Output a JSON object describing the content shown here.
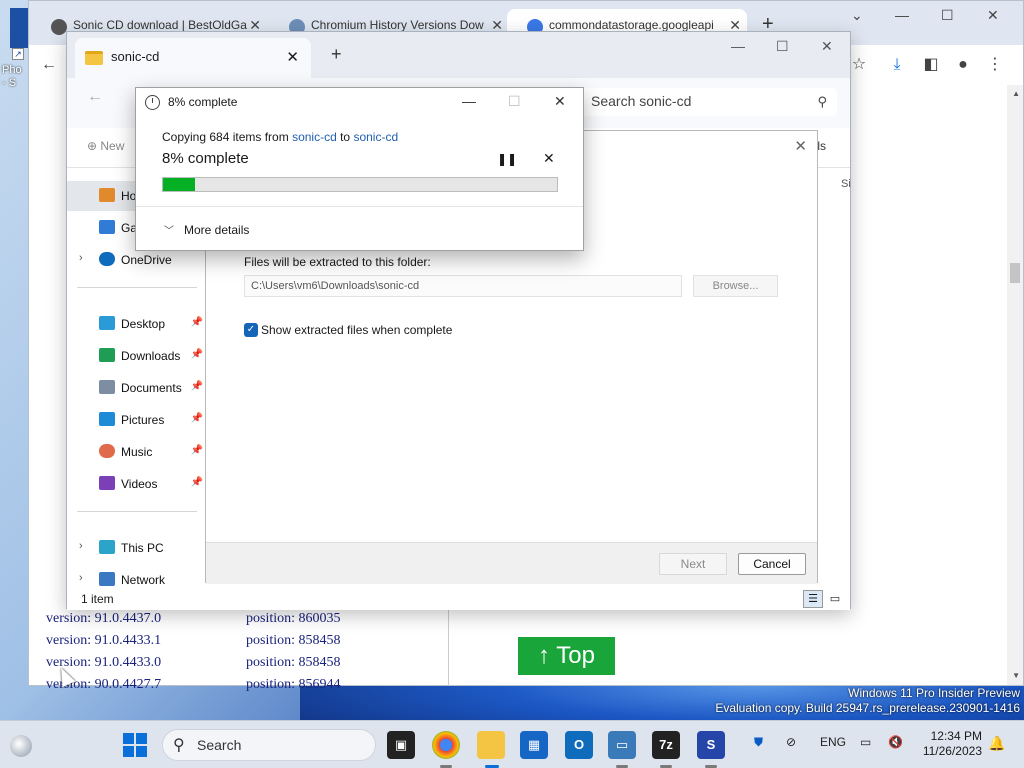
{
  "desktop": {
    "icon_label": "Pho\n- S",
    "watermark_line1": "Windows 11 Pro Insider Preview",
    "watermark_line2": "Evaluation copy. Build 25947.rs_prerelease.230901-1416"
  },
  "browser": {
    "tabs": [
      {
        "title": "Sonic CD download | BestOldGa",
        "close": "✕"
      },
      {
        "title": "Chromium History Versions Dow",
        "close": "✕"
      },
      {
        "title": "commondatastorage.googleapi",
        "close": "✕"
      }
    ],
    "new_tab": "+",
    "versions": [
      {
        "version": "version: 91.0.4437.0",
        "position": "position: 860035"
      },
      {
        "version": "version: 91.0.4433.1",
        "position": "position: 858458"
      },
      {
        "version": "version: 91.0.4433.0",
        "position": "position: 858458"
      },
      {
        "version": "version: 90.0.4427.7",
        "position": "position: 856944"
      }
    ],
    "top_button": "↑ Top"
  },
  "explorer": {
    "tab_title": "sonic-cd",
    "search_placeholder": "Search sonic-cd",
    "new_label": "New",
    "details_label": "ls",
    "col_header": "Si",
    "sidebar": [
      {
        "label": "Ho",
        "icon": "home-icon"
      },
      {
        "label": "Ga",
        "icon": "gallery-icon"
      },
      {
        "label": "OneDrive",
        "icon": "onedrive-icon"
      },
      {
        "label": "Desktop",
        "icon": "desktop-icon"
      },
      {
        "label": "Downloads",
        "icon": "downloads-icon"
      },
      {
        "label": "Documents",
        "icon": "documents-icon"
      },
      {
        "label": "Pictures",
        "icon": "pictures-icon"
      },
      {
        "label": "Music",
        "icon": "music-icon"
      },
      {
        "label": "Videos",
        "icon": "videos-icon"
      },
      {
        "label": "This PC",
        "icon": "this-pc-icon"
      },
      {
        "label": "Network",
        "icon": "network-icon"
      }
    ],
    "status": "1 item"
  },
  "wizard": {
    "folder_label": "Files will be extracted to this folder:",
    "path": "C:\\Users\\vm6\\Downloads\\sonic-cd",
    "browse": "Browse...",
    "show_files_label": "Show extracted files when complete",
    "show_files_checked": true,
    "next": "Next",
    "cancel": "Cancel"
  },
  "progress": {
    "title": "8% complete",
    "copying_prefix": "Copying 684 items from ",
    "source": "sonic-cd",
    "middle": " to ",
    "dest": "sonic-cd",
    "big": "8% complete",
    "percent": 8,
    "more_details": "More details"
  },
  "taskbar": {
    "search": "Search",
    "lang": "ENG",
    "time": "12:34 PM",
    "date": "11/26/2023"
  },
  "colors": {
    "progress_fill": "#06b025",
    "top_button": "#1aa53a",
    "link": "#1f5fb0",
    "accent": "#0a6fd8"
  }
}
